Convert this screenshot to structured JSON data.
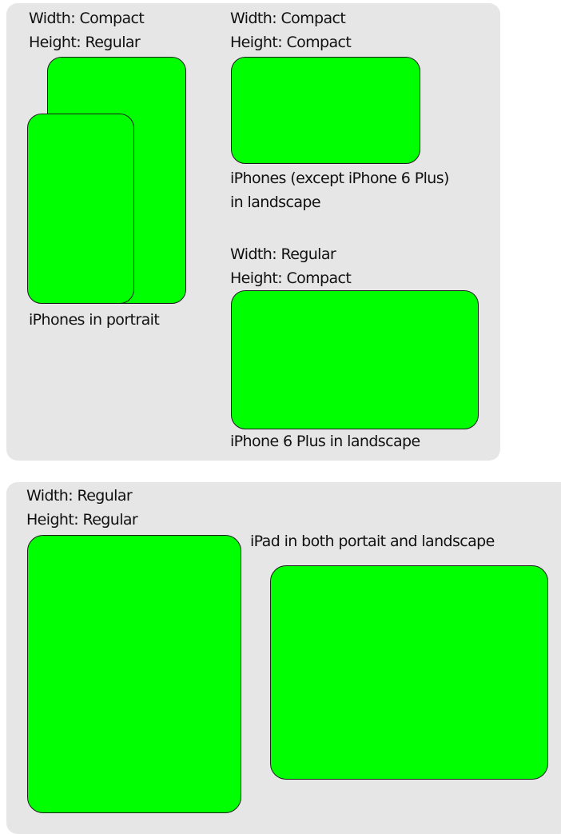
{
  "colors": {
    "panel": "#e6e6e6",
    "screen": "#00ff00",
    "outline": "#1c1c1c",
    "text": "#111111"
  },
  "top_panel": {
    "compact_regular": {
      "width_label": "Width: Compact",
      "height_label": "Height: Regular",
      "caption": "iPhones in portrait"
    },
    "compact_compact": {
      "width_label": "Width: Compact",
      "height_label": "Height: Compact",
      "caption_line1": "iPhones (except iPhone 6 Plus)",
      "caption_line2": "in landscape"
    },
    "regular_compact": {
      "width_label": "Width: Regular",
      "height_label": "Height: Compact",
      "caption": "iPhone 6 Plus in landscape"
    }
  },
  "bottom_panel": {
    "regular_regular": {
      "width_label": "Width: Regular",
      "height_label": "Height: Regular",
      "caption": "iPad in both portait and landscape"
    }
  }
}
